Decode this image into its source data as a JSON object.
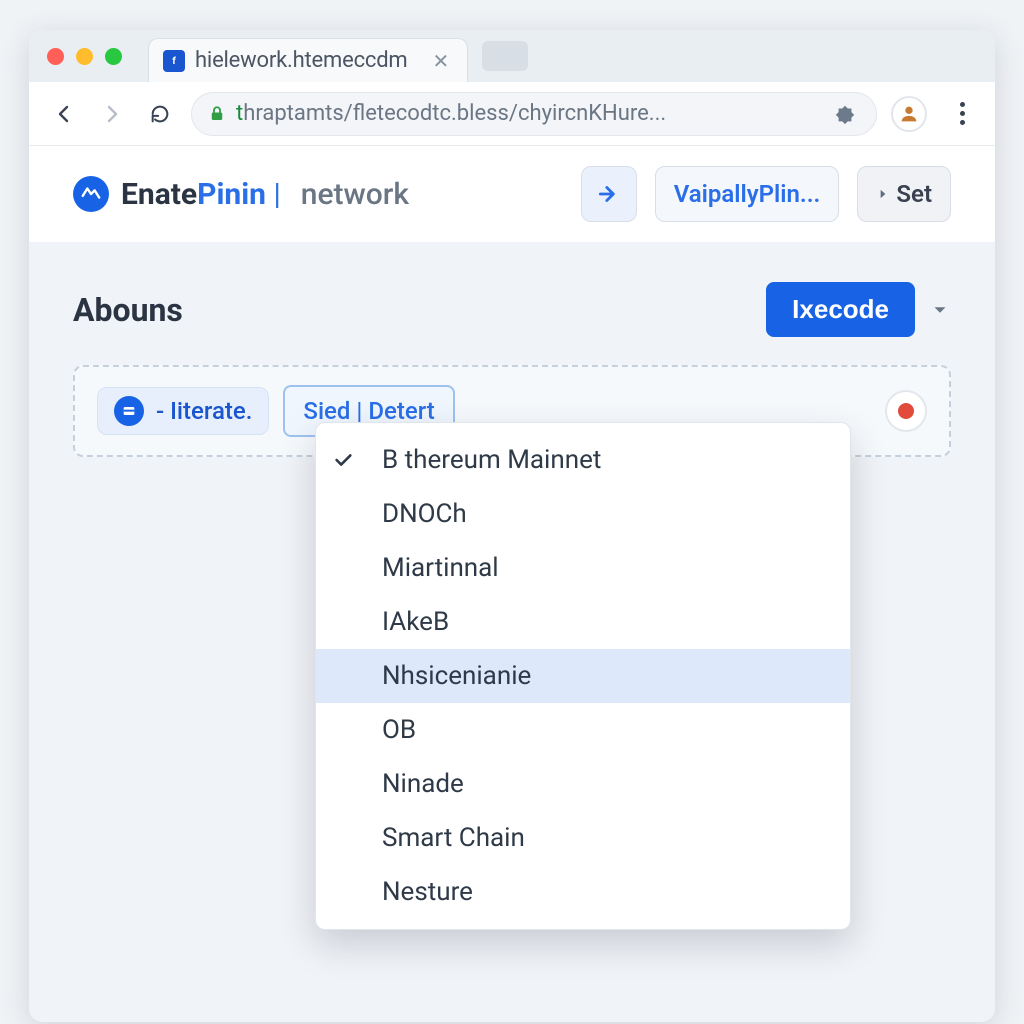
{
  "browser": {
    "tab_title": "hielework.htemeccdm",
    "address_green": "t",
    "address_rest_1": "hraptamts/",
    "address_rest_2": "fletecodtc.bless/",
    "address_rest_3": "chyircnKHure",
    "address_ellipsis": "..."
  },
  "header": {
    "brand_a": "Enate",
    "brand_b": "Pinin",
    "brand_bar": "|",
    "brand_c": "network",
    "wallet_label": "VaipallyPlin...",
    "set_label": "Set"
  },
  "section": {
    "title": "Abouns",
    "primary_button": "Ixecode"
  },
  "account_row": {
    "pill_label": "- Iiterate.",
    "network_select_label": "Sied | Detert"
  },
  "network_menu": {
    "options": [
      "B thereum Mainnet",
      "DNOCh",
      "Miartinnal",
      "IAkeB",
      "Nhsicenianie",
      "OB",
      "Ninade",
      "Smart Chain",
      "Nesture"
    ],
    "selected_index": 0,
    "highlight_index": 4
  }
}
